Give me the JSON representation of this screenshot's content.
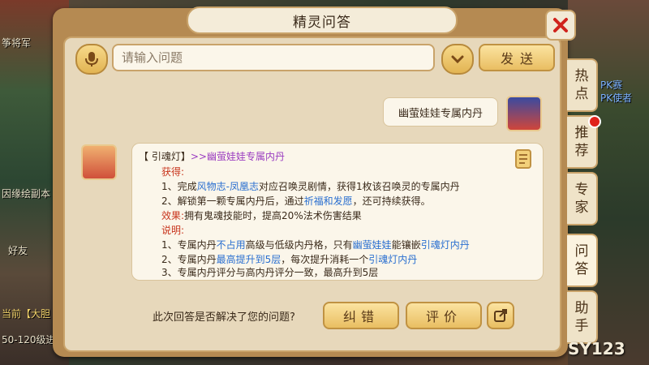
{
  "window": {
    "title": "精灵问答"
  },
  "input": {
    "placeholder": "请输入问题",
    "send_label": "发送"
  },
  "side_tabs": [
    {
      "label": "热点"
    },
    {
      "label": "推荐"
    },
    {
      "label": "专家"
    },
    {
      "label": "问答"
    },
    {
      "label": "助手"
    }
  ],
  "user_message": "幽萤娃娃专属内丹",
  "answer": {
    "header_tag": "【 引魂灯】",
    "header_link": ">>幽萤娃娃专属内丹",
    "obtain_title": "获得:",
    "obtain_1a": "1、完成",
    "obtain_1_link": "风物志-凤凰志",
    "obtain_1b": "对应召唤灵剧情，获得1枚该召唤灵的专属内丹",
    "obtain_2a": "2、解锁第一颗专属内丹后，通过",
    "obtain_2_link": "祈福和发愿",
    "obtain_2b": "，还可持续获得。",
    "effect_title": "效果:",
    "effect_text": "拥有鬼魂技能时，提高20%法术伤害结果",
    "note_title": "说明:",
    "note_1a": "1、专属内丹",
    "note_1_link1": "不占用",
    "note_1b": "高级与低级内丹格，只有",
    "note_1_link2": "幽萤娃娃",
    "note_1c": "能镶嵌",
    "note_1_link3": "引魂灯内丹",
    "note_2a": "2、专属内丹",
    "note_2_link1": "最高提升到5层",
    "note_2b": "，每次提升消耗一个",
    "note_2_link2": "引魂灯内丹",
    "note_3": "3、专属内丹评分与高内丹评分一致，最高升到5层"
  },
  "feedback": {
    "question": "此次回答是否解决了您的问题?",
    "correct_label": "纠错",
    "rate_label": "评价"
  },
  "background": {
    "left_texts": [
      "筝将军",
      "因缘绘副本",
      "好友",
      "当前【大胆",
      "50-120级进"
    ],
    "right_texts": [
      "PK赛",
      "PK使者"
    ]
  },
  "watermark": "SY123",
  "colors": {
    "accent": "#e9be62",
    "link": "#2a6fd0",
    "highlight": "#c8341c",
    "close": "#d0231c"
  },
  "icons": {
    "mic": "microphone-icon",
    "dropdown": "chevron-down-icon",
    "close": "close-icon",
    "share": "share-icon",
    "scroll": "scroll-icon"
  }
}
